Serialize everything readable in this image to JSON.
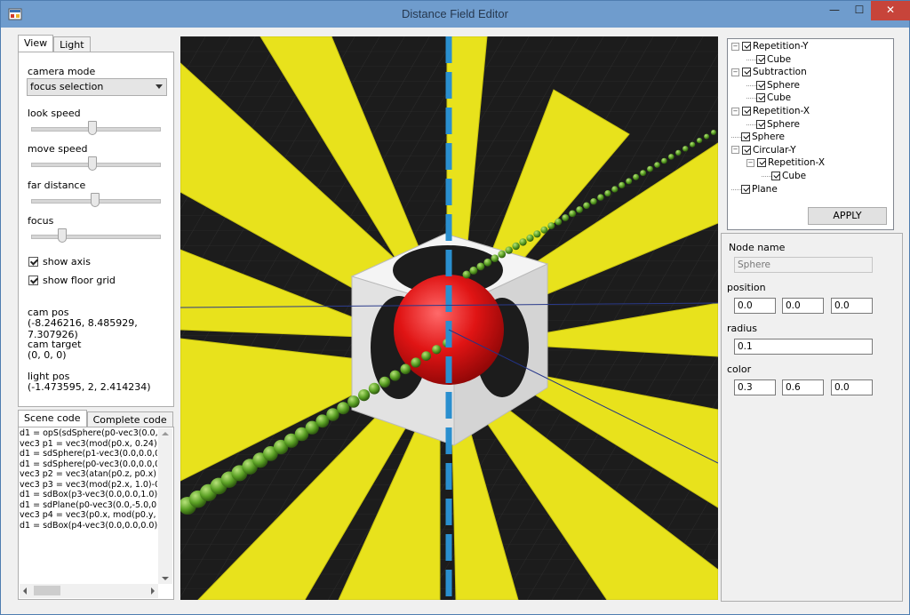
{
  "window": {
    "title": "Distance Field Editor",
    "minimize": "—",
    "maximize": "☐",
    "close": "✕"
  },
  "left_tabs": [
    "View",
    "Light"
  ],
  "view": {
    "camera_mode_label": "camera mode",
    "camera_mode_value": "focus selection",
    "look_speed_label": "look speed",
    "look_speed_level": 0.47,
    "move_speed_label": "move speed",
    "move_speed_level": 0.47,
    "far_distance_label": "far distance",
    "far_distance_level": 0.49,
    "focus_label": "focus",
    "focus_level": 0.22,
    "show_axis_label": "show axis",
    "show_axis_checked": true,
    "show_floor_grid_label": "show floor grid",
    "show_floor_grid_checked": true,
    "cam_pos_label": "cam pos",
    "cam_pos_value": "(-8.246216, 8.485929, 7.307926)",
    "cam_target_label": "cam target",
    "cam_target_value": "(0, 0, 0)",
    "light_pos_label": "light pos",
    "light_pos_value": "(-1.473595, 2, 2.414234)"
  },
  "code_tabs": [
    "Scene code",
    "Complete code"
  ],
  "scene_code": [
    "d1 = opS(sdSphere(p0-vec3(0.0,0.0,0",
    "vec3 p1 = vec3(mod(p0.x, 0.24)-0.5",
    "d1 = sdSphere(p1-vec3(0.0,0.0,0.0),",
    "d1 = sdSphere(p0-vec3(0.0,0.0,0.0),",
    "vec3 p2 = vec3(atan(p0.z, p0.x) * 8",
    "vec3 p3 = vec3(mod(p2.x, 1.0)-0.5*",
    "d1 = sdBox(p3-vec3(0.0,0.0,1.0),vec",
    "d1 = sdPlane(p0-vec3(0.0,-5.0,0.0),v",
    "vec3 p4 = vec3(p0.x, mod(p0.y, 1.0)",
    "d1 = sdBox(p4-vec3(0.0,0.0,0.0),vec"
  ],
  "tree": [
    {
      "label": "Repetition-Y",
      "depth": 0,
      "expander": "−"
    },
    {
      "label": "Cube",
      "depth": 1,
      "expander": ""
    },
    {
      "label": "Subtraction",
      "depth": 0,
      "expander": "−"
    },
    {
      "label": "Sphere",
      "depth": 1,
      "expander": ""
    },
    {
      "label": "Cube",
      "depth": 1,
      "expander": ""
    },
    {
      "label": "Repetition-X",
      "depth": 0,
      "expander": "−"
    },
    {
      "label": "Sphere",
      "depth": 1,
      "expander": ""
    },
    {
      "label": "Sphere",
      "depth": 0,
      "expander": ""
    },
    {
      "label": "Circular-Y",
      "depth": 0,
      "expander": "−"
    },
    {
      "label": "Repetition-X",
      "depth": 1,
      "expander": "−"
    },
    {
      "label": "Cube",
      "depth": 2,
      "expander": ""
    },
    {
      "label": "Plane",
      "depth": 0,
      "expander": ""
    }
  ],
  "apply_label": "APPLY",
  "props": {
    "node_name_label": "Node name",
    "node_name_value": "Sphere",
    "position_label": "position",
    "position": [
      "0.0",
      "0.0",
      "0.0"
    ],
    "radius_label": "radius",
    "radius": "0.1",
    "color_label": "color",
    "color": [
      "0.3",
      "0.6",
      "0.0"
    ]
  },
  "colors": {
    "titlebar": "#6f9ccd",
    "close_button": "#c7443a",
    "viewport_bg": "#1a1a1a",
    "fan_yellow": "#e8e21c",
    "sphere_red": "#e01414",
    "balls_green": "#5aa024",
    "axis_blue": "#2a8fcf",
    "cube_white": "#ececec"
  }
}
